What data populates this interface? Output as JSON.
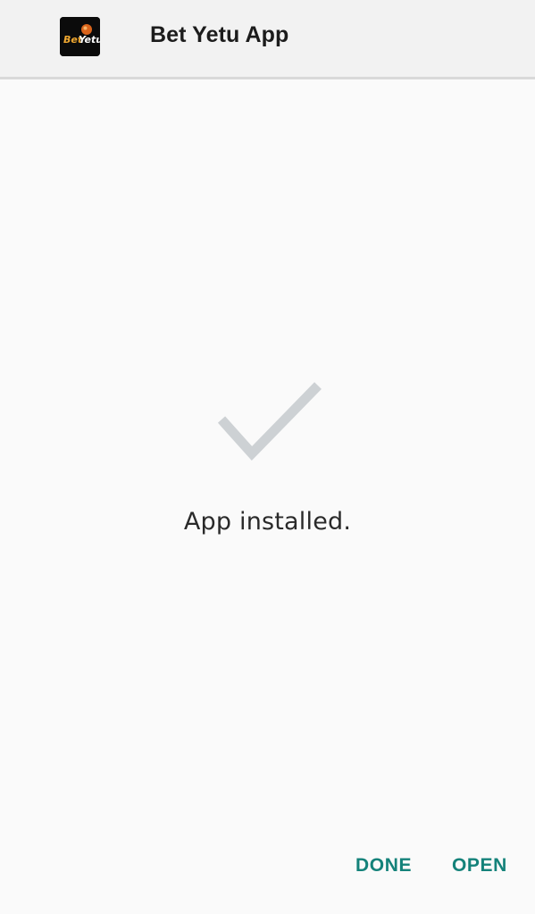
{
  "header": {
    "app_name": "Bet Yetu App",
    "app_icon": "bet-yetu-logo",
    "app_icon_text": "BetYetu"
  },
  "status": {
    "icon": "checkmark-icon",
    "message": "App installed."
  },
  "actions": {
    "done_label": "DONE",
    "open_label": "OPEN"
  },
  "colors": {
    "accent": "#14827a",
    "header_background": "#f2f2f2",
    "background": "#fafafa",
    "checkmark": "#cdd1d4"
  }
}
